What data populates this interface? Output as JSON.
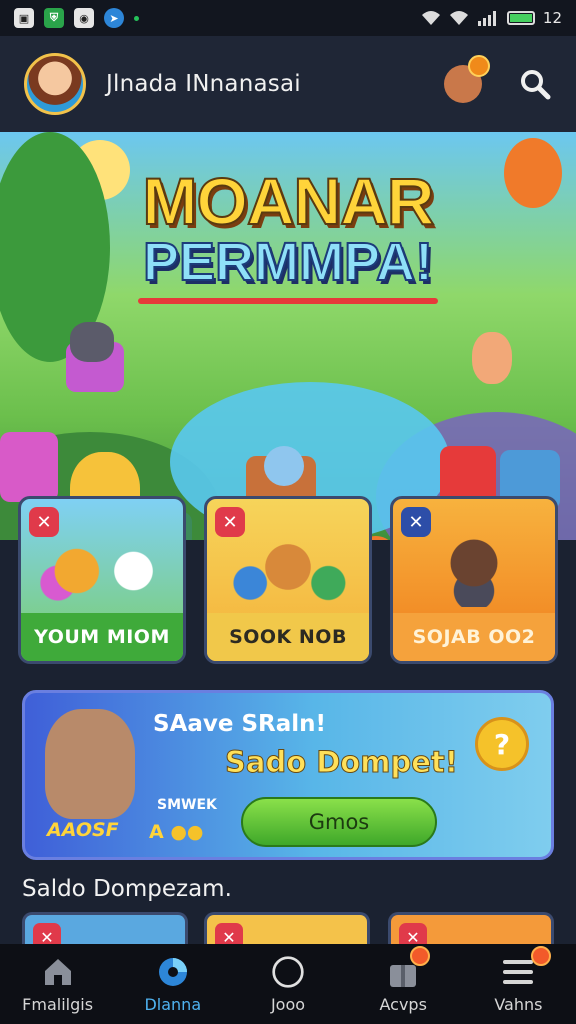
{
  "status_bar": {
    "time": "12",
    "left_icons": [
      "image-icon",
      "shield-icon",
      "messenger-icon",
      "telegram-icon"
    ]
  },
  "header": {
    "username": "Jlnada INnanasai",
    "avatar": "avatar-girl",
    "actions": [
      "bag-icon",
      "search-icon"
    ]
  },
  "banner": {
    "title_line1": "MOANAR",
    "title_line2": "PERMMPA!"
  },
  "game_cards": [
    {
      "label": "YOUM MIOM",
      "tag_icon": "close-icon"
    },
    {
      "label": "SOOK NOB",
      "tag_icon": "close-icon"
    },
    {
      "label": "SOJAB OO2",
      "tag_icon": "close-icon"
    }
  ],
  "promo": {
    "title": "SAave SRaln!",
    "headline": "Sado Dompet!",
    "sub_label": "SMWEK",
    "coins_text": "A",
    "bunny_caption": "AAOSF",
    "coin_glyph": "?",
    "cta_label": "Gmos"
  },
  "section": {
    "title": "Saldo Dompezam."
  },
  "bottom_nav": [
    {
      "label": "Fmalilgis",
      "icon": "home-icon",
      "active": false
    },
    {
      "label": "Dlanna",
      "icon": "discover-icon",
      "active": true
    },
    {
      "label": "Jooo",
      "icon": "circle-icon",
      "active": false
    },
    {
      "label": "Acvps",
      "icon": "gift-icon",
      "active": false
    },
    {
      "label": "Vahns",
      "icon": "menu-icon",
      "active": false
    }
  ],
  "colors": {
    "background": "#1b2231",
    "accent_active": "#4fb2ef",
    "cta_green": "#3fa82a",
    "badge_orange": "#f08a1a"
  }
}
